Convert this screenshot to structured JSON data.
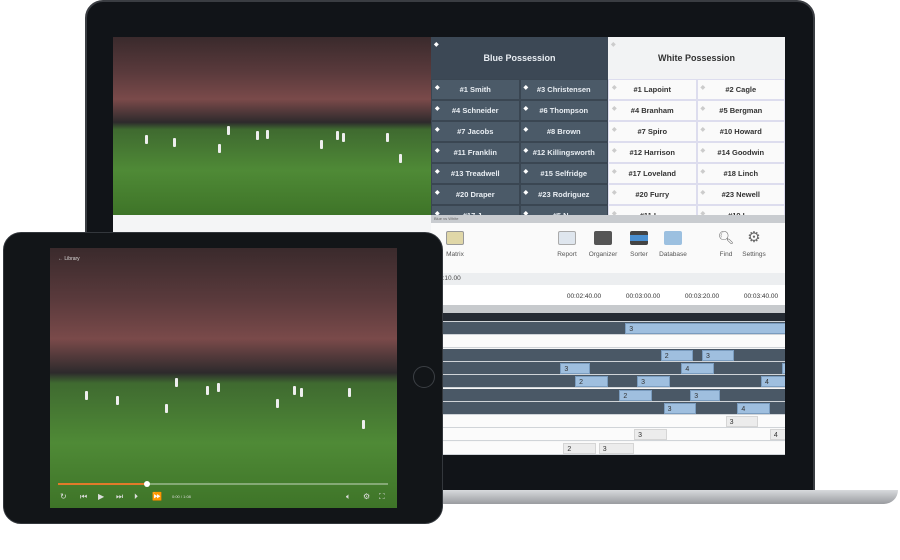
{
  "matrix": {
    "blue": {
      "title": "Blue Possession",
      "players": [
        "#1 Smith",
        "#3 Christensen",
        "#4 Schneider",
        "#6 Thompson",
        "#7 Jacobs",
        "#8 Brown",
        "#11 Franklin",
        "#12 Killingsworth",
        "#13 Treadwell",
        "#15 Selfridge",
        "#20 Draper",
        "#23 Rodriguez",
        "#17 J...",
        "#5 N..."
      ]
    },
    "white": {
      "title": "White Possession",
      "players": [
        "#1 Lapoint",
        "#2 Cagle",
        "#4 Branham",
        "#5 Bergman",
        "#7 Spiro",
        "#10 Howard",
        "#12 Harrison",
        "#14 Goodwin",
        "#17 Loveland",
        "#18 Linch",
        "#20 Furry",
        "#23 Newell",
        "#11 L...",
        "#19 L..."
      ]
    },
    "strip_label": "Blue vs White"
  },
  "toolbar": {
    "matrix": "Matrix",
    "report": "Report",
    "organizer": "Organizer",
    "sorter": "Sorter",
    "database": "Database",
    "find": "Find",
    "settings": "Settings"
  },
  "timeline": {
    "current": "4:10.00",
    "ticks": [
      "00:02:40.00",
      "00:03:00.00",
      "00:03:20.00",
      "00:03:40.00",
      "00:04:00.00",
      "00:04:20.00"
    ],
    "tick_seconds": [
      160,
      180,
      200,
      220,
      240,
      260
    ],
    "playhead_seconds": 251,
    "playhead_color": "#c8332b",
    "rows": [
      {
        "style": "dark",
        "segments": [
          {
            "label": "3",
            "start": 174,
            "end": 242
          },
          {
            "label": "4",
            "start": 245,
            "end": 256
          }
        ]
      },
      {
        "style": "light",
        "segments": [
          {
            "label": "6",
            "start": 257,
            "end": 272
          }
        ]
      },
      {
        "style": "dark",
        "segments": [
          {
            "label": "2",
            "start": 186,
            "end": 197
          },
          {
            "label": "3",
            "start": 200,
            "end": 211
          },
          {
            "label": "4",
            "start": 233,
            "end": 244
          },
          {
            "label": "5",
            "start": 245,
            "end": 256
          }
        ]
      },
      {
        "style": "dark",
        "segments": [
          {
            "label": "3",
            "start": 152,
            "end": 162
          },
          {
            "label": "4",
            "start": 193,
            "end": 204
          },
          {
            "label": "5",
            "start": 227,
            "end": 238
          }
        ]
      },
      {
        "style": "dark",
        "segments": [
          {
            "label": "2",
            "start": 157,
            "end": 168
          },
          {
            "label": "3",
            "start": 178,
            "end": 189
          },
          {
            "label": "4",
            "start": 220,
            "end": 230
          },
          {
            "label": "5",
            "start": 253,
            "end": 264
          }
        ]
      },
      {
        "style": "dark",
        "segments": [
          {
            "label": "2",
            "start": 172,
            "end": 183
          },
          {
            "label": "3",
            "start": 196,
            "end": 206
          },
          {
            "label": "4",
            "start": 247,
            "end": 258
          }
        ]
      },
      {
        "style": "dark",
        "segments": [
          {
            "label": "3",
            "start": 187,
            "end": 198
          },
          {
            "label": "4",
            "start": 212,
            "end": 223
          },
          {
            "label": "5",
            "start": 234,
            "end": 245
          }
        ]
      },
      {
        "style": "light",
        "segments": [
          {
            "label": "3",
            "start": 208,
            "end": 219
          },
          {
            "label": "4",
            "start": 231,
            "end": 242
          },
          {
            "label": "5",
            "start": 256,
            "end": 268
          }
        ]
      },
      {
        "style": "light",
        "segments": [
          {
            "label": "3",
            "start": 177,
            "end": 188
          },
          {
            "label": "4",
            "start": 223,
            "end": 234
          },
          {
            "label": "5",
            "start": 239,
            "end": 250
          }
        ]
      },
      {
        "style": "light",
        "segments": [
          {
            "label": "2",
            "start": 153,
            "end": 164
          },
          {
            "label": "3",
            "start": 165,
            "end": 177
          },
          {
            "label": "4",
            "start": 238,
            "end": 248
          }
        ]
      }
    ]
  },
  "tablet": {
    "back_label": "Library",
    "time": "0:00 / 1:08",
    "progress": 0.27,
    "accent": "#e07a2a"
  }
}
